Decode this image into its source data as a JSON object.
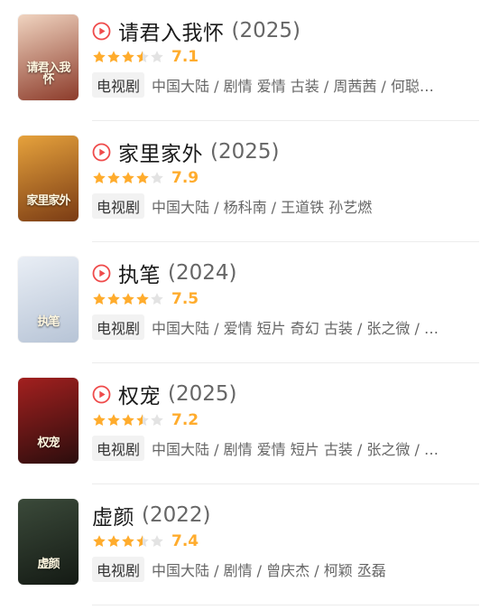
{
  "colors": {
    "accent_play": "#ef4b4b",
    "star_filled": "#ffac2d",
    "star_empty": "#e3e3e3",
    "score": "#ffac2d"
  },
  "items": [
    {
      "poster_icon": "poster-image",
      "poster_text": "请君入我怀",
      "poster_colors": [
        "#f0d4c0",
        "#8c3b2a"
      ],
      "has_play_icon": true,
      "title": "请君入我怀",
      "year": "(2025)",
      "stars": 3.5,
      "score": "7.1",
      "badge": "电视剧",
      "info": "中国大陆 / 剧情 爱情 古装 / 周茜茜 / 何聪…"
    },
    {
      "poster_icon": "poster-image",
      "poster_text": "家里家外",
      "poster_colors": [
        "#e6a23c",
        "#7a3b14"
      ],
      "has_play_icon": true,
      "title": "家里家外",
      "year": "(2025)",
      "stars": 4,
      "score": "7.9",
      "badge": "电视剧",
      "info": "中国大陆 / 杨科南 / 王道铁 孙艺燃"
    },
    {
      "poster_icon": "poster-image",
      "poster_text": "执笔",
      "poster_colors": [
        "#e9eef5",
        "#b7c4d6"
      ],
      "has_play_icon": true,
      "title": "执笔",
      "year": "(2024)",
      "stars": 4,
      "score": "7.5",
      "badge": "电视剧",
      "info": "中国大陆 / 爱情 短片 奇幻 古装 / 张之微 / …"
    },
    {
      "poster_icon": "poster-image",
      "poster_text": "权宠",
      "poster_colors": [
        "#a3201f",
        "#2b0d0d"
      ],
      "has_play_icon": true,
      "title": "权宠",
      "year": "(2025)",
      "stars": 3.5,
      "score": "7.2",
      "badge": "电视剧",
      "info": "中国大陆 / 剧情 爱情 短片 古装 / 张之微 / …"
    },
    {
      "poster_icon": "poster-image",
      "poster_text": "虚颜",
      "poster_colors": [
        "#3b4a3a",
        "#141a14"
      ],
      "has_play_icon": false,
      "title": "虚颜",
      "year": "(2022)",
      "stars": 3.5,
      "score": "7.4",
      "badge": "电视剧",
      "info": "中国大陆 / 剧情 / 曾庆杰 / 柯颖 丞磊"
    }
  ]
}
